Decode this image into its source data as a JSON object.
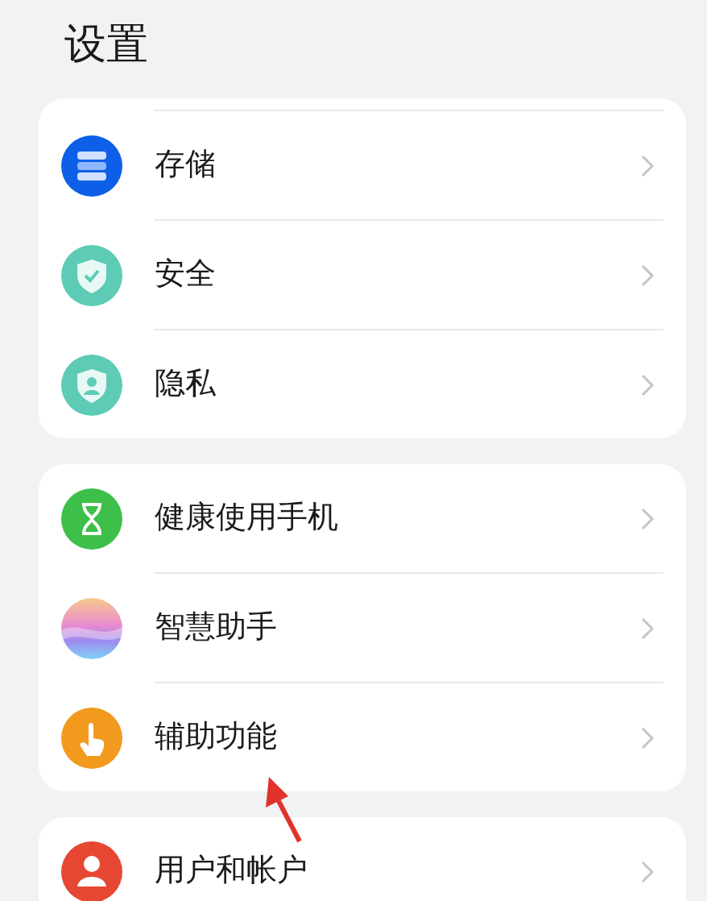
{
  "title": "设置",
  "groups": [
    {
      "items": [
        {
          "label": "存储",
          "kind": "storage"
        },
        {
          "label": "安全",
          "kind": "security"
        },
        {
          "label": "隐私",
          "kind": "privacy"
        }
      ]
    },
    {
      "items": [
        {
          "label": "健康使用手机",
          "kind": "hourglass"
        },
        {
          "label": "智慧助手",
          "kind": "assistant"
        },
        {
          "label": "辅助功能",
          "kind": "accessibility"
        }
      ]
    },
    {
      "items": [
        {
          "label": "用户和帐户",
          "kind": "user"
        }
      ]
    }
  ]
}
